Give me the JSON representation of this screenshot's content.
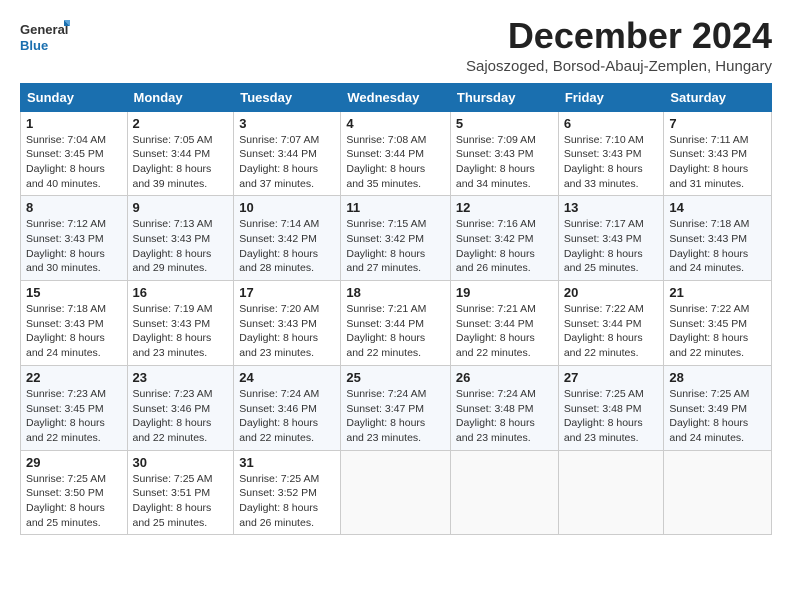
{
  "logo": {
    "text_general": "General",
    "text_blue": "Blue"
  },
  "header": {
    "month_year": "December 2024",
    "location": "Sajoszoged, Borsod-Abauj-Zemplen, Hungary"
  },
  "weekdays": [
    "Sunday",
    "Monday",
    "Tuesday",
    "Wednesday",
    "Thursday",
    "Friday",
    "Saturday"
  ],
  "weeks": [
    [
      {
        "day": "1",
        "info": "Sunrise: 7:04 AM\nSunset: 3:45 PM\nDaylight: 8 hours\nand 40 minutes."
      },
      {
        "day": "2",
        "info": "Sunrise: 7:05 AM\nSunset: 3:44 PM\nDaylight: 8 hours\nand 39 minutes."
      },
      {
        "day": "3",
        "info": "Sunrise: 7:07 AM\nSunset: 3:44 PM\nDaylight: 8 hours\nand 37 minutes."
      },
      {
        "day": "4",
        "info": "Sunrise: 7:08 AM\nSunset: 3:44 PM\nDaylight: 8 hours\nand 35 minutes."
      },
      {
        "day": "5",
        "info": "Sunrise: 7:09 AM\nSunset: 3:43 PM\nDaylight: 8 hours\nand 34 minutes."
      },
      {
        "day": "6",
        "info": "Sunrise: 7:10 AM\nSunset: 3:43 PM\nDaylight: 8 hours\nand 33 minutes."
      },
      {
        "day": "7",
        "info": "Sunrise: 7:11 AM\nSunset: 3:43 PM\nDaylight: 8 hours\nand 31 minutes."
      }
    ],
    [
      {
        "day": "8",
        "info": "Sunrise: 7:12 AM\nSunset: 3:43 PM\nDaylight: 8 hours\nand 30 minutes."
      },
      {
        "day": "9",
        "info": "Sunrise: 7:13 AM\nSunset: 3:43 PM\nDaylight: 8 hours\nand 29 minutes."
      },
      {
        "day": "10",
        "info": "Sunrise: 7:14 AM\nSunset: 3:42 PM\nDaylight: 8 hours\nand 28 minutes."
      },
      {
        "day": "11",
        "info": "Sunrise: 7:15 AM\nSunset: 3:42 PM\nDaylight: 8 hours\nand 27 minutes."
      },
      {
        "day": "12",
        "info": "Sunrise: 7:16 AM\nSunset: 3:42 PM\nDaylight: 8 hours\nand 26 minutes."
      },
      {
        "day": "13",
        "info": "Sunrise: 7:17 AM\nSunset: 3:43 PM\nDaylight: 8 hours\nand 25 minutes."
      },
      {
        "day": "14",
        "info": "Sunrise: 7:18 AM\nSunset: 3:43 PM\nDaylight: 8 hours\nand 24 minutes."
      }
    ],
    [
      {
        "day": "15",
        "info": "Sunrise: 7:18 AM\nSunset: 3:43 PM\nDaylight: 8 hours\nand 24 minutes."
      },
      {
        "day": "16",
        "info": "Sunrise: 7:19 AM\nSunset: 3:43 PM\nDaylight: 8 hours\nand 23 minutes."
      },
      {
        "day": "17",
        "info": "Sunrise: 7:20 AM\nSunset: 3:43 PM\nDaylight: 8 hours\nand 23 minutes."
      },
      {
        "day": "18",
        "info": "Sunrise: 7:21 AM\nSunset: 3:44 PM\nDaylight: 8 hours\nand 22 minutes."
      },
      {
        "day": "19",
        "info": "Sunrise: 7:21 AM\nSunset: 3:44 PM\nDaylight: 8 hours\nand 22 minutes."
      },
      {
        "day": "20",
        "info": "Sunrise: 7:22 AM\nSunset: 3:44 PM\nDaylight: 8 hours\nand 22 minutes."
      },
      {
        "day": "21",
        "info": "Sunrise: 7:22 AM\nSunset: 3:45 PM\nDaylight: 8 hours\nand 22 minutes."
      }
    ],
    [
      {
        "day": "22",
        "info": "Sunrise: 7:23 AM\nSunset: 3:45 PM\nDaylight: 8 hours\nand 22 minutes."
      },
      {
        "day": "23",
        "info": "Sunrise: 7:23 AM\nSunset: 3:46 PM\nDaylight: 8 hours\nand 22 minutes."
      },
      {
        "day": "24",
        "info": "Sunrise: 7:24 AM\nSunset: 3:46 PM\nDaylight: 8 hours\nand 22 minutes."
      },
      {
        "day": "25",
        "info": "Sunrise: 7:24 AM\nSunset: 3:47 PM\nDaylight: 8 hours\nand 23 minutes."
      },
      {
        "day": "26",
        "info": "Sunrise: 7:24 AM\nSunset: 3:48 PM\nDaylight: 8 hours\nand 23 minutes."
      },
      {
        "day": "27",
        "info": "Sunrise: 7:25 AM\nSunset: 3:48 PM\nDaylight: 8 hours\nand 23 minutes."
      },
      {
        "day": "28",
        "info": "Sunrise: 7:25 AM\nSunset: 3:49 PM\nDaylight: 8 hours\nand 24 minutes."
      }
    ],
    [
      {
        "day": "29",
        "info": "Sunrise: 7:25 AM\nSunset: 3:50 PM\nDaylight: 8 hours\nand 25 minutes."
      },
      {
        "day": "30",
        "info": "Sunrise: 7:25 AM\nSunset: 3:51 PM\nDaylight: 8 hours\nand 25 minutes."
      },
      {
        "day": "31",
        "info": "Sunrise: 7:25 AM\nSunset: 3:52 PM\nDaylight: 8 hours\nand 26 minutes."
      },
      {
        "day": "",
        "info": ""
      },
      {
        "day": "",
        "info": ""
      },
      {
        "day": "",
        "info": ""
      },
      {
        "day": "",
        "info": ""
      }
    ]
  ]
}
